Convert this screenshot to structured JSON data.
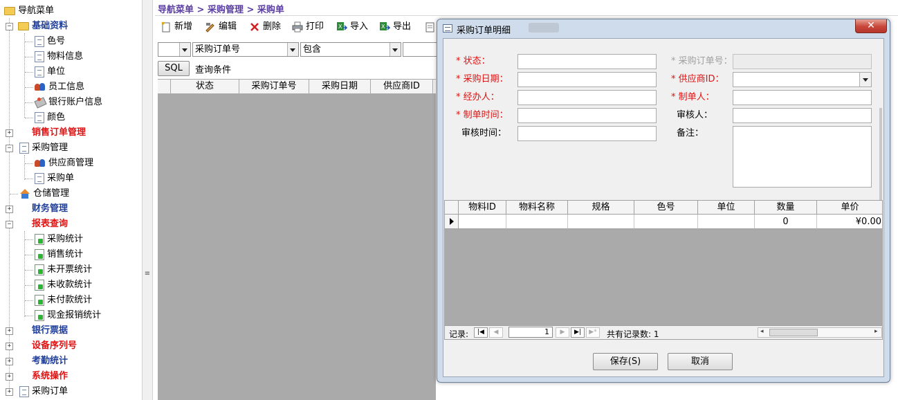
{
  "tree": {
    "root": "导航菜单",
    "items": [
      {
        "label": "基础资料",
        "level": 1,
        "style": "bold-blue",
        "expanded": true
      },
      {
        "label": "色号",
        "level": 2
      },
      {
        "label": "物料信息",
        "level": 2
      },
      {
        "label": "单位",
        "level": 2
      },
      {
        "label": "员工信息",
        "level": 2
      },
      {
        "label": "银行账户信息",
        "level": 2
      },
      {
        "label": "颜色",
        "level": 2
      },
      {
        "label": "销售订单管理",
        "level": 1,
        "style": "bold-red",
        "expanded": false
      },
      {
        "label": "采购管理",
        "level": 1,
        "style": "normal",
        "expanded": true
      },
      {
        "label": "供应商管理",
        "level": 2
      },
      {
        "label": "采购单",
        "level": 2
      },
      {
        "label": "仓储管理",
        "level": 1,
        "style": "normal"
      },
      {
        "label": "财务管理",
        "level": 1,
        "style": "bold-blue",
        "expanded": false
      },
      {
        "label": "报表查询",
        "level": 1,
        "style": "bold-red",
        "expanded": true
      },
      {
        "label": "采购统计",
        "level": 2
      },
      {
        "label": "销售统计",
        "level": 2
      },
      {
        "label": "未开票统计",
        "level": 2
      },
      {
        "label": "未收款统计",
        "level": 2
      },
      {
        "label": "未付款统计",
        "level": 2
      },
      {
        "label": "现金报销统计",
        "level": 2
      },
      {
        "label": "银行票据",
        "level": 1,
        "style": "bold-blue",
        "expanded": false
      },
      {
        "label": "设备序列号",
        "level": 1,
        "style": "bold-red",
        "expanded": false
      },
      {
        "label": "考勤统计",
        "level": 1,
        "style": "bold-blue",
        "expanded": false
      },
      {
        "label": "系统操作",
        "level": 1,
        "style": "bold-red",
        "expanded": false
      },
      {
        "label": "采购订单",
        "level": 1,
        "style": "normal",
        "expanded": false
      }
    ]
  },
  "breadcrumb": "导航菜单 > 采购管理 > 采购单",
  "toolbar": {
    "add": "新增",
    "edit": "编辑",
    "delete": "删除",
    "print": "打印",
    "import": "导入",
    "export": "导出"
  },
  "filter": {
    "field": "采购订单号",
    "operator": "包含",
    "value": ""
  },
  "sql_button": "SQL",
  "query_condition": "查询条件",
  "grid_columns": [
    "状态",
    "采购订单号",
    "采购日期",
    "供应商ID"
  ],
  "dialog": {
    "title": "采购订单明细",
    "close_glyph": "✕",
    "fields": {
      "status": {
        "label": "* 状态：",
        "value": ""
      },
      "order_no": {
        "label": "* 采购订单号：",
        "value": ""
      },
      "purchase_date": {
        "label": "* 采购日期：",
        "value": ""
      },
      "supplier_id": {
        "label": "* 供应商ID：",
        "value": ""
      },
      "handler": {
        "label": "* 经办人：",
        "value": ""
      },
      "creator": {
        "label": "* 制单人：",
        "value": ""
      },
      "create_time": {
        "label": "* 制单时间：",
        "value": ""
      },
      "reviewer": {
        "label": "审核人：",
        "value": ""
      },
      "review_time": {
        "label": "审核时间：",
        "value": ""
      },
      "remark": {
        "label": "备注：",
        "value": ""
      }
    },
    "detail_columns": [
      "物料ID",
      "物料名称",
      "规格",
      "色号",
      "单位",
      "数量",
      "单价"
    ],
    "detail_rows": [
      {
        "material_id": "",
        "material_name": "",
        "spec": "",
        "color_no": "",
        "unit": "",
        "quantity": "0",
        "unit_price": "¥0.00"
      }
    ],
    "nav": {
      "record_label": "记录:",
      "current_record": "1",
      "total_label": "共有记录数: 1"
    },
    "save_button": "保存(S)",
    "cancel_button": "取消"
  },
  "colors": {
    "required": "#e01212",
    "tree_blue": "#1f3f9a",
    "breadcrumb": "#5a3ea0",
    "grid_empty": "#aaaaaa"
  }
}
